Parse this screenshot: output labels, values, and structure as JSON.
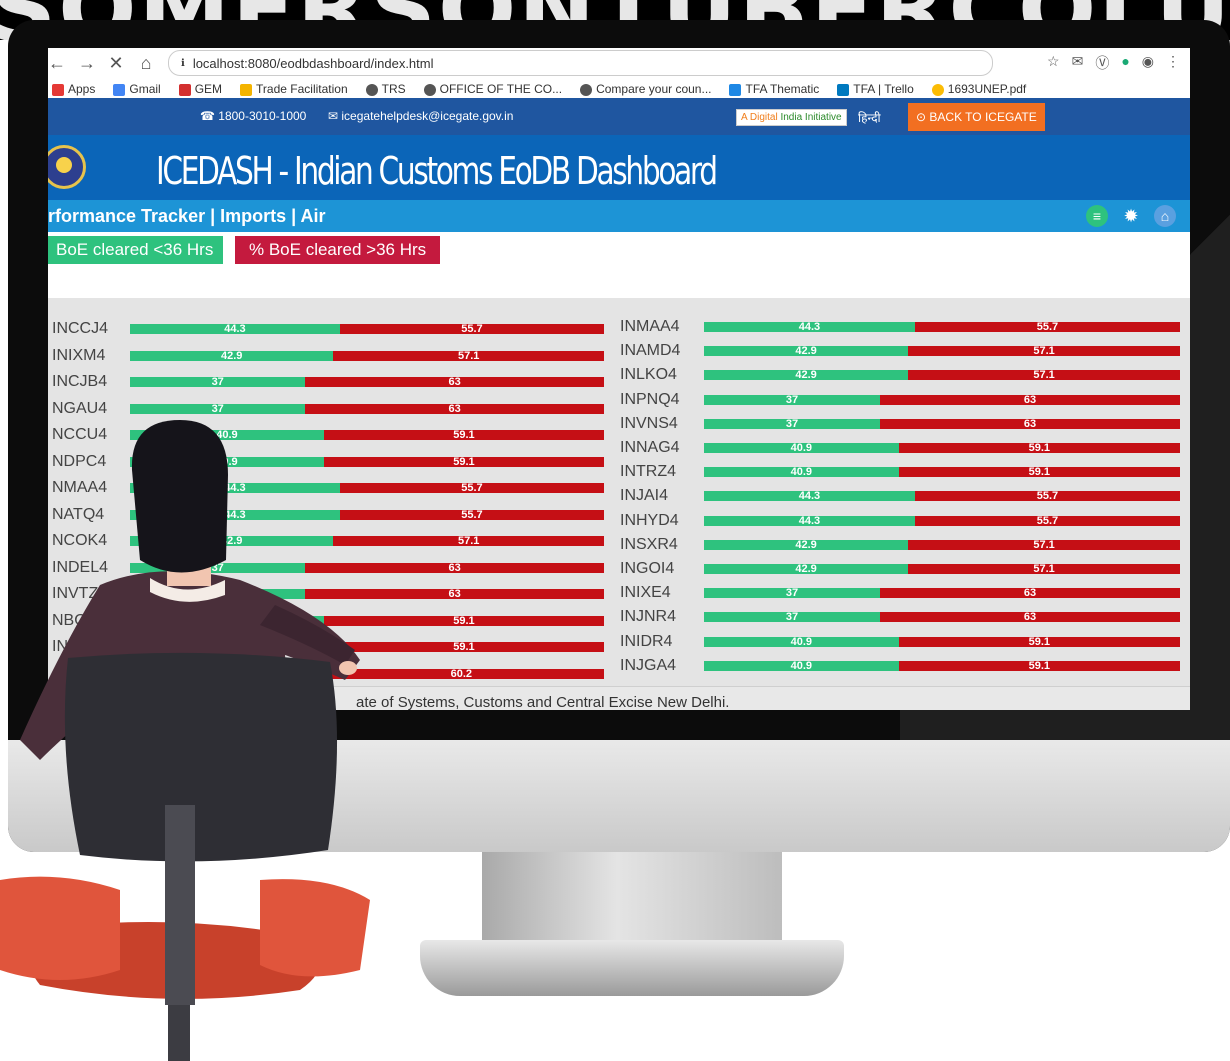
{
  "browser": {
    "url": "localhost:8080/eodbdashboard/index.html",
    "bookmarks": [
      "Apps",
      "Gmail",
      "GEM",
      "Trade Facilitation",
      "TRS",
      "OFFICE OF THE CO...",
      "Compare your coun...",
      "TFA Thematic",
      "TFA | Trello",
      "1693UNEP.pdf"
    ]
  },
  "contact": {
    "phone": "1800-3010-1000",
    "email": "icegatehelpdesk@icegate.gov.in",
    "digital_prefix": "A Digital",
    "digital_suffix": "India Initiative",
    "hindi": "हिन्दी",
    "back": "BACK TO ICEGATE"
  },
  "header": {
    "title": "ICEDASH - Indian Customs EoDB Dashboard"
  },
  "tracker": {
    "title": "rformance Tracker | Imports | Air"
  },
  "legend": {
    "green": "BoE cleared <36 Hrs",
    "red": "% BoE cleared >36 Hrs"
  },
  "footer": {
    "text": "ate of Systems, Customs and Central Excise New Delhi."
  },
  "chart_data": {
    "type": "bar",
    "title": "",
    "series": [
      {
        "name": "BoE cleared <36 Hrs",
        "color": "#2ec27e"
      },
      {
        "name": "% BoE cleared >36 Hrs",
        "color": "#c50f15"
      }
    ],
    "left_panel": [
      {
        "label": "INCCJ4",
        "green": 44.3,
        "red": 55.7
      },
      {
        "label": "INIXM4",
        "green": 42.9,
        "red": 57.1
      },
      {
        "label": "INCJB4",
        "green": 37,
        "red": 63
      },
      {
        "label": "NGAU4",
        "green": 37,
        "red": 63
      },
      {
        "label": "NCCU4",
        "green": 40.9,
        "red": 59.1
      },
      {
        "label": "NDPC4",
        "green": 40.9,
        "red": 59.1
      },
      {
        "label": "NMAA4",
        "green": 44.3,
        "red": 55.7
      },
      {
        "label": "NATQ4",
        "green": 44.3,
        "red": 55.7
      },
      {
        "label": "NCOK4",
        "green": 42.9,
        "red": 57.1
      },
      {
        "label": "INDEL4",
        "green": 37,
        "red": 63
      },
      {
        "label": "INVTZ4",
        "green": 37,
        "red": 63
      },
      {
        "label": "NBOI",
        "green": 40.9,
        "red": 59.1
      },
      {
        "label": "IN",
        "green": 40.9,
        "red": 59.1
      },
      {
        "label": "",
        "green": 39.8,
        "red": 60.2
      }
    ],
    "right_panel": [
      {
        "label": "INMAA4",
        "green": 44.3,
        "red": 55.7
      },
      {
        "label": "INAMD4",
        "green": 42.9,
        "red": 57.1
      },
      {
        "label": "INLKO4",
        "green": 42.9,
        "red": 57.1
      },
      {
        "label": "INPNQ4",
        "green": 37,
        "red": 63
      },
      {
        "label": "INVNS4",
        "green": 37,
        "red": 63
      },
      {
        "label": "INNAG4",
        "green": 40.9,
        "red": 59.1
      },
      {
        "label": "INTRZ4",
        "green": 40.9,
        "red": 59.1
      },
      {
        "label": "INJAI4",
        "green": 44.3,
        "red": 55.7
      },
      {
        "label": "INHYD4",
        "green": 44.3,
        "red": 55.7
      },
      {
        "label": "INSXR4",
        "green": 42.9,
        "red": 57.1
      },
      {
        "label": "INGOI4",
        "green": 42.9,
        "red": 57.1
      },
      {
        "label": "INIXE4",
        "green": 37,
        "red": 63
      },
      {
        "label": "INJNR4",
        "green": 37,
        "red": 63
      },
      {
        "label": "INIDR4",
        "green": 40.9,
        "red": 59.1
      },
      {
        "label": "INJGA4",
        "green": 40.9,
        "red": 59.1
      }
    ]
  }
}
